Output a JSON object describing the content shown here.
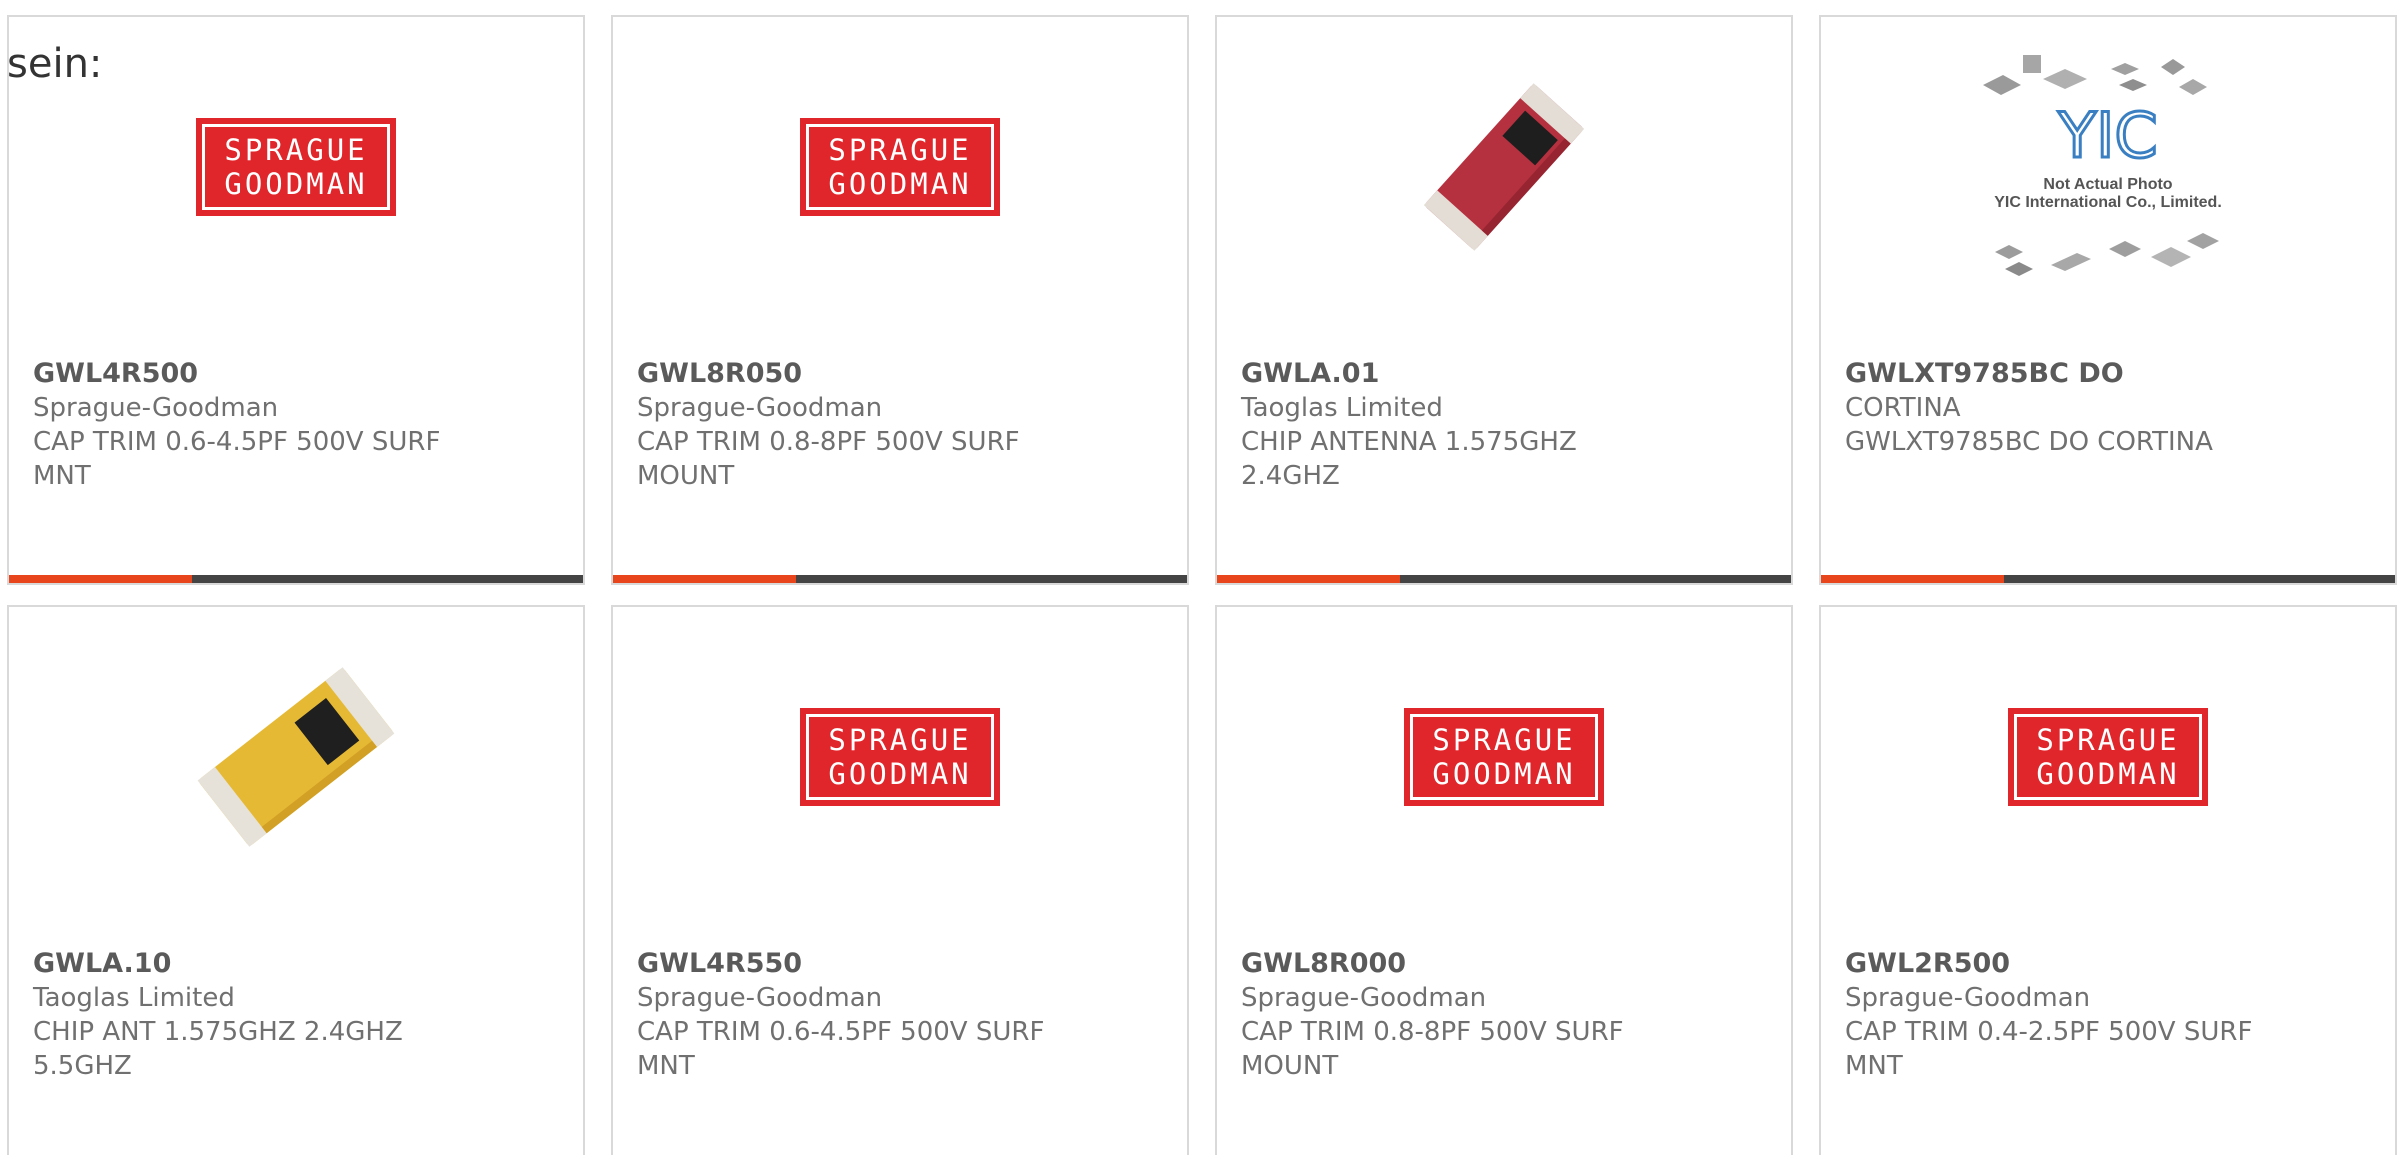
{
  "prefix": "sein:",
  "colors": {
    "accent": "#e8451c",
    "bar": "#444444",
    "logo_red": "#e0252b",
    "chip_red": "#b5313f",
    "chip_yellow": "#e6b935"
  },
  "logos": {
    "sprague_goodman": [
      "SPRAGUE",
      "GOODMAN"
    ],
    "yic_mark": "YIC",
    "yic_caption_1": "Not Actual Photo",
    "yic_caption_2": "YIC International Co., Limited."
  },
  "products": [
    {
      "image": "sprague-goodman-logo",
      "part_number": "GWL4R500",
      "manufacturer": "Sprague-Goodman",
      "description": "CAP TRIM 0.6-4.5PF 500V SURF MNT"
    },
    {
      "image": "sprague-goodman-logo",
      "part_number": "GWL8R050",
      "manufacturer": "Sprague-Goodman",
      "description": "CAP TRIM 0.8-8PF 500V SURF MOUNT"
    },
    {
      "image": "red-chip-antenna-photo",
      "part_number": "GWLA.01",
      "manufacturer": "Taoglas Limited",
      "description": "CHIP ANTENNA 1.575GHZ 2.4GHZ"
    },
    {
      "image": "yic-not-actual-photo",
      "part_number": "GWLXT9785BC DO",
      "manufacturer": "CORTINA",
      "description": "GWLXT9785BC DO CORTINA"
    },
    {
      "image": "yellow-chip-antenna-photo",
      "part_number": "GWLA.10",
      "manufacturer": "Taoglas Limited",
      "description": "CHIP ANT 1.575GHZ 2.4GHZ 5.5GHZ"
    },
    {
      "image": "sprague-goodman-logo",
      "part_number": "GWL4R550",
      "manufacturer": "Sprague-Goodman",
      "description": "CAP TRIM 0.6-4.5PF 500V SURF MNT"
    },
    {
      "image": "sprague-goodman-logo",
      "part_number": "GWL8R000",
      "manufacturer": "Sprague-Goodman",
      "description": "CAP TRIM 0.8-8PF 500V SURF MOUNT"
    },
    {
      "image": "sprague-goodman-logo",
      "part_number": "GWL2R500",
      "manufacturer": "Sprague-Goodman",
      "description": "CAP TRIM 0.4-2.5PF 500V SURF MNT"
    }
  ]
}
